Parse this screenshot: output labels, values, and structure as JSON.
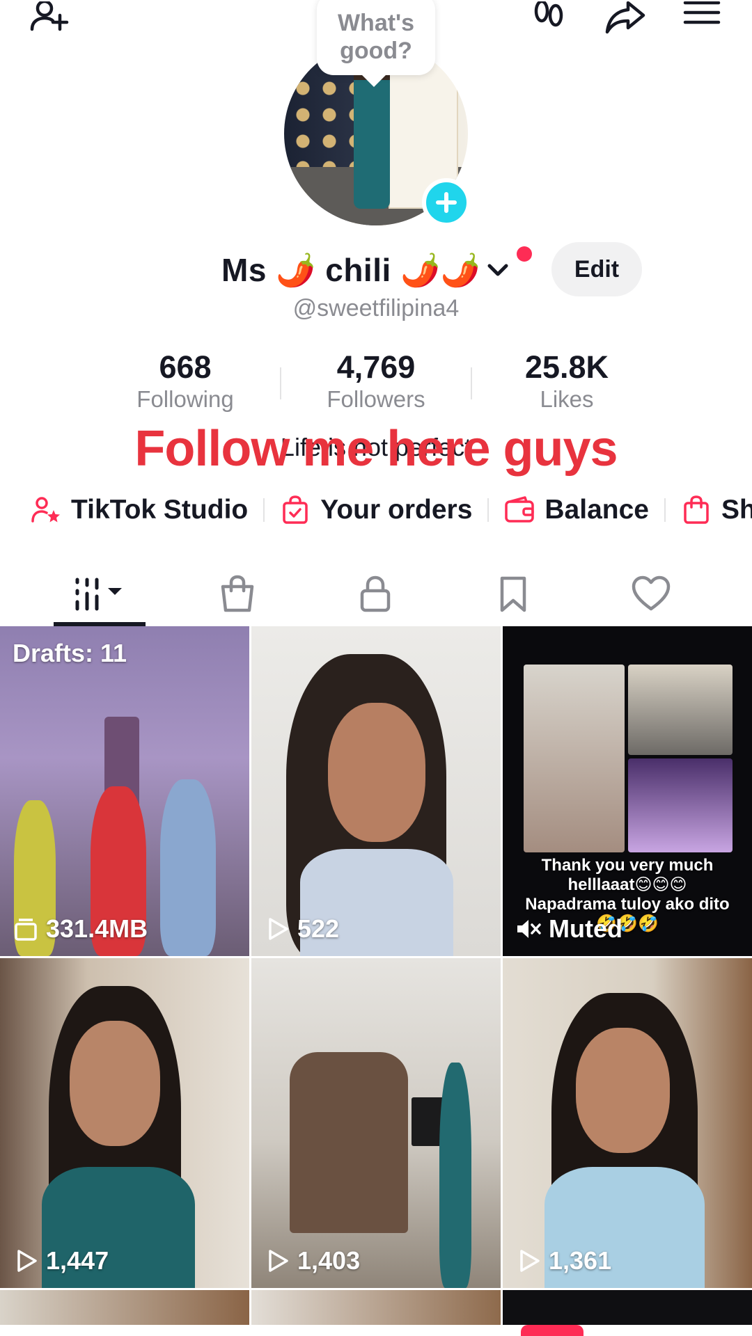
{
  "header": {
    "add_friend_icon": "add-user-icon",
    "footprints_icon": "footprints-icon",
    "share_icon": "share-icon",
    "menu_icon": "menu-icon"
  },
  "bubble": {
    "line1": "What's",
    "line2": "good?"
  },
  "profile": {
    "name": "Ms 🌶️ chili 🌶️🌶️",
    "username": "@sweetfilipina4",
    "edit_label": "Edit",
    "bio": "Life is not perfect",
    "overlay_text": "Follow me here guys"
  },
  "stats": [
    {
      "value": "668",
      "label": "Following"
    },
    {
      "value": "4,769",
      "label": "Followers"
    },
    {
      "value": "25.8K",
      "label": "Likes"
    }
  ],
  "shortcuts": [
    {
      "label": "TikTok Studio",
      "icon": "studio-icon"
    },
    {
      "label": "Your orders",
      "icon": "orders-icon"
    },
    {
      "label": "Balance",
      "icon": "wallet-icon"
    },
    {
      "label": "Sho",
      "icon": "shop-icon"
    }
  ],
  "tabs": [
    {
      "name": "videos",
      "icon": "grid-icon",
      "active": true
    },
    {
      "name": "shop",
      "icon": "bag-icon"
    },
    {
      "name": "private",
      "icon": "lock-icon"
    },
    {
      "name": "saved",
      "icon": "bookmark-icon"
    },
    {
      "name": "liked",
      "icon": "heart-icon"
    }
  ],
  "grid": {
    "drafts_label": "Drafts: 11",
    "items": [
      {
        "stat": "331.4MB",
        "stat_icon": "drafts-icon"
      },
      {
        "stat": "522",
        "stat_icon": "play-icon"
      },
      {
        "stat": "Muted",
        "stat_icon": "muted-icon",
        "live_lines": [
          "Thank you very much",
          "helllaaat😊😊😊",
          "Napadrama tuloy ako dito",
          "🤣🤣🤣"
        ]
      },
      {
        "stat": "1,447",
        "stat_icon": "play-icon"
      },
      {
        "stat": "1,403",
        "stat_icon": "play-icon"
      },
      {
        "stat": "1,361",
        "stat_icon": "play-icon"
      }
    ]
  },
  "colors": {
    "accent": "#fe2c55",
    "overlay_red": "#e8333e",
    "add_button": "#20d5ec",
    "text_secondary": "#8a8b91"
  }
}
